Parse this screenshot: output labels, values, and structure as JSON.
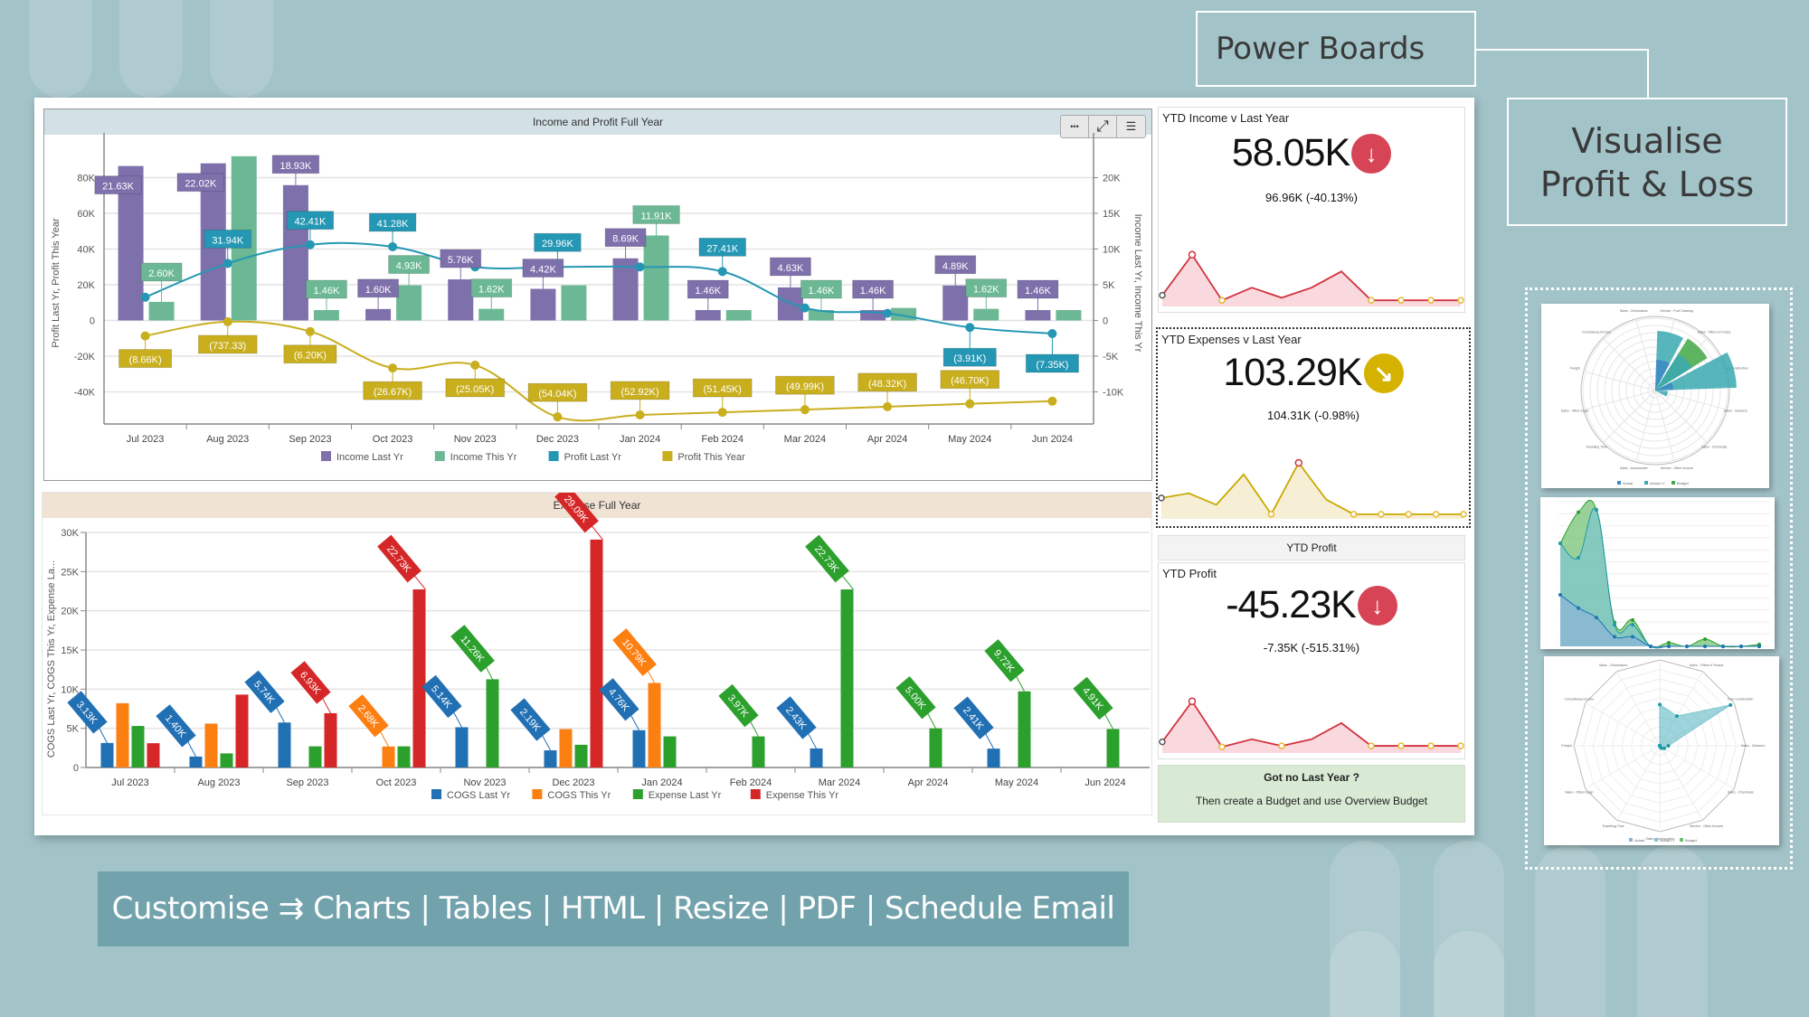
{
  "callouts": {
    "power_boards": "Power Boards",
    "visualise_line1": "Visualise",
    "visualise_line2": "Profit & Loss"
  },
  "banner": {
    "text": "Customise ⇉ Charts | Tables | HTML | Resize | PDF | Schedule Email"
  },
  "toolbar": {
    "more_icon": "more-icon",
    "expand_icon": "expand-icon",
    "list_icon": "list-icon",
    "more_glyph": "•••",
    "expand_glyph": "⤢",
    "list_glyph": "☰"
  },
  "colors": {
    "income_last": "#7e70ab",
    "income_this": "#6cb894",
    "profit_last": "#2497b4",
    "profit_this": "#c9ae1e",
    "cogs_last": "#2270b4",
    "cogs_this": "#fc7f12",
    "expense_last": "#2ca02c",
    "expense_this": "#d62728",
    "kpi_down_red": "#d64455",
    "kpi_down_yellow": "#d6b200",
    "note_bg": "#d8ead4"
  },
  "chart_data": [
    {
      "type": "bar",
      "title": "Income and Profit Full Year",
      "categories": [
        "Jul 2023",
        "Aug 2023",
        "Sep 2023",
        "Oct 2023",
        "Nov 2023",
        "Dec 2023",
        "Jan 2024",
        "Feb 2024",
        "Mar 2024",
        "Apr 2024",
        "May 2024",
        "Jun 2024"
      ],
      "ylabel_left": "Profit Last Yr, Profit This Year",
      "ylabel_right": "Income Last Yr, Income This Yr",
      "left_ticks": [
        "80K",
        "60K",
        "40K",
        "20K",
        "0",
        "-20K",
        "-40K"
      ],
      "right_ticks": [
        "20K",
        "15K",
        "10K",
        "5K",
        "0",
        "-5K",
        "-10K"
      ],
      "ylim_left": [
        -58000,
        100000
      ],
      "ylim_right": [
        -14500,
        25000
      ],
      "legend": [
        "Income Last Yr",
        "Income This Yr",
        "Profit Last Yr",
        "Profit This Year"
      ],
      "legend_position": "bottom",
      "series": [
        {
          "name": "Income Last Yr",
          "kind": "bar",
          "axis": "left",
          "values": [
            86500,
            88000,
            75800,
            6400,
            23000,
            17700,
            34800,
            5800,
            18500,
            5800,
            19600,
            5800
          ],
          "labels": [
            "21.63K",
            "22.02K",
            "18.93K",
            "1.60K",
            "5.76K",
            "4.42K",
            "8.69K",
            "1.46K",
            "4.63K",
            "1.46K",
            "4.89K",
            "1.46K"
          ]
        },
        {
          "name": "Income This Yr",
          "kind": "bar",
          "axis": "left",
          "values": [
            10400,
            92000,
            5800,
            19700,
            6500,
            19700,
            47600,
            5800,
            5800,
            7000,
            6500,
            5800
          ],
          "labels": [
            "2.60K",
            "",
            "1.46K",
            "4.93K",
            "1.62K",
            "",
            "11.91K",
            "",
            "1.46K",
            "",
            "1.62K",
            ""
          ]
        },
        {
          "name": "Profit Last Yr",
          "kind": "line",
          "axis": "left",
          "values": [
            13000,
            31940,
            42410,
            41280,
            30000,
            30000,
            30000,
            27410,
            7000,
            4000,
            -3910,
            -7350
          ],
          "labels": [
            "",
            "31.94K",
            "42.41K",
            "41.28K",
            "",
            "29.96K",
            "",
            "27.41K",
            "",
            "",
            "(3.91K)",
            "(7.35K)"
          ]
        },
        {
          "name": "Profit This Year",
          "kind": "line",
          "axis": "left",
          "values": [
            -8660,
            -737.33,
            -6200,
            -26670,
            -25050,
            -54040,
            -52920,
            -51450,
            -49990,
            -48320,
            -46700,
            -45230
          ],
          "labels": [
            "(8.66K)",
            "(737.33)",
            "(6.20K)",
            "(26.67K)",
            "(25.05K)",
            "(54.04K)",
            "(52.92K)",
            "(51.45K)",
            "(49.99K)",
            "(48.32K)",
            "(46.70K)",
            ""
          ]
        }
      ]
    },
    {
      "type": "bar",
      "title": "Expense Full Year",
      "categories": [
        "Jul 2023",
        "Aug 2023",
        "Sep 2023",
        "Oct 2023",
        "Nov 2023",
        "Dec 2023",
        "Jan 2024",
        "Feb 2024",
        "Mar 2024",
        "Apr 2024",
        "May 2024",
        "Jun 2024"
      ],
      "ylabel": "COGS Last Yr, COGS This Yr, Expense La...",
      "ticks": [
        "30K",
        "25K",
        "20K",
        "15K",
        "10K",
        "5K",
        "0"
      ],
      "ylim": [
        0,
        30000
      ],
      "legend": [
        "COGS Last Yr",
        "COGS This Yr",
        "Expense Last Yr",
        "Expense This Yr"
      ],
      "legend_position": "bottom",
      "series": [
        {
          "name": "COGS Last Yr",
          "values": [
            3130,
            1400,
            5740,
            0,
            5140,
            2190,
            4760,
            0,
            2430,
            0,
            2410,
            0
          ],
          "labels": [
            "3.13K",
            "1.40K",
            "5.74K",
            "",
            "5.14K",
            "2.19K",
            "4.76K",
            "",
            "2.43K",
            "",
            "2.41K",
            ""
          ]
        },
        {
          "name": "COGS This Yr",
          "values": [
            8200,
            5600,
            0,
            2680,
            0,
            4900,
            10790,
            0,
            0,
            0,
            0,
            0
          ],
          "labels": [
            "",
            "",
            "",
            "2.68K",
            "",
            "",
            "10.79K",
            "",
            "",
            "",
            "",
            ""
          ]
        },
        {
          "name": "Expense Last Yr",
          "values": [
            5300,
            1800,
            2700,
            2700,
            11260,
            2900,
            3970,
            3970,
            22730,
            5000,
            9720,
            4910
          ],
          "labels": [
            "",
            "",
            "",
            "",
            "11.26K",
            "",
            "",
            "3.97K",
            "22.73K",
            "5.00K",
            "9.72K",
            "4.91K"
          ]
        },
        {
          "name": "Expense This Yr",
          "values": [
            3100,
            9300,
            6930,
            22730,
            0,
            29090,
            0,
            0,
            0,
            0,
            0,
            0
          ],
          "labels": [
            "",
            "",
            "6.93K",
            "22.73K",
            "",
            "29.09K",
            "",
            "",
            "",
            "",
            "",
            ""
          ]
        }
      ]
    }
  ],
  "kpis": [
    {
      "title": "YTD Income v Last Year",
      "value": "58.05K",
      "sub": "96.96K (-40.13%)",
      "badge_icon": "arrow-down-icon",
      "badge_glyph": "↓",
      "trend": "down",
      "spark": [
        0.15,
        0.95,
        0.05,
        0.3,
        0.1,
        0.3,
        0.62,
        0.05,
        0.05,
        0.05,
        0.05
      ]
    },
    {
      "title": "YTD Expenses v Last Year",
      "value": "103.29K",
      "sub": "104.31K (-0.98%)",
      "badge_icon": "arrow-down-right-icon",
      "badge_glyph": "↘",
      "trend": "slightly-down",
      "spark": [
        0.33,
        0.42,
        0.2,
        0.78,
        0.02,
        1.0,
        0.3,
        0.02,
        0.02,
        0.02,
        0.02,
        0.02
      ]
    },
    {
      "header": "YTD Profit",
      "title": "YTD Profit",
      "value": "-45.23K",
      "sub": "-7.35K (-515.31%)",
      "badge_icon": "arrow-down-icon",
      "badge_glyph": "↓",
      "trend": "down",
      "spark": [
        0.15,
        0.95,
        0.05,
        0.2,
        0.07,
        0.2,
        0.52,
        0.07,
        0.07,
        0.07,
        0.07
      ]
    }
  ],
  "note": {
    "title": "Got no Last Year ?",
    "body": "Then create a Budget and use Overview Budget"
  },
  "thumbnails": {
    "polar_labels": [
      "Sales - Chlorinators",
      "Service - Pool Cleaning",
      "Sales - Filters & Pumps",
      "Pool Construction",
      "Sales - Cleaners",
      "Sales - Chemicals",
      "Service - Other Income",
      "Sales - Accessories",
      "Travelling Time",
      "Sales - Other Equip",
      "Freight",
      "Consultancy Income"
    ],
    "legend": [
      "Actual",
      "Actual LY",
      "Budget"
    ]
  }
}
